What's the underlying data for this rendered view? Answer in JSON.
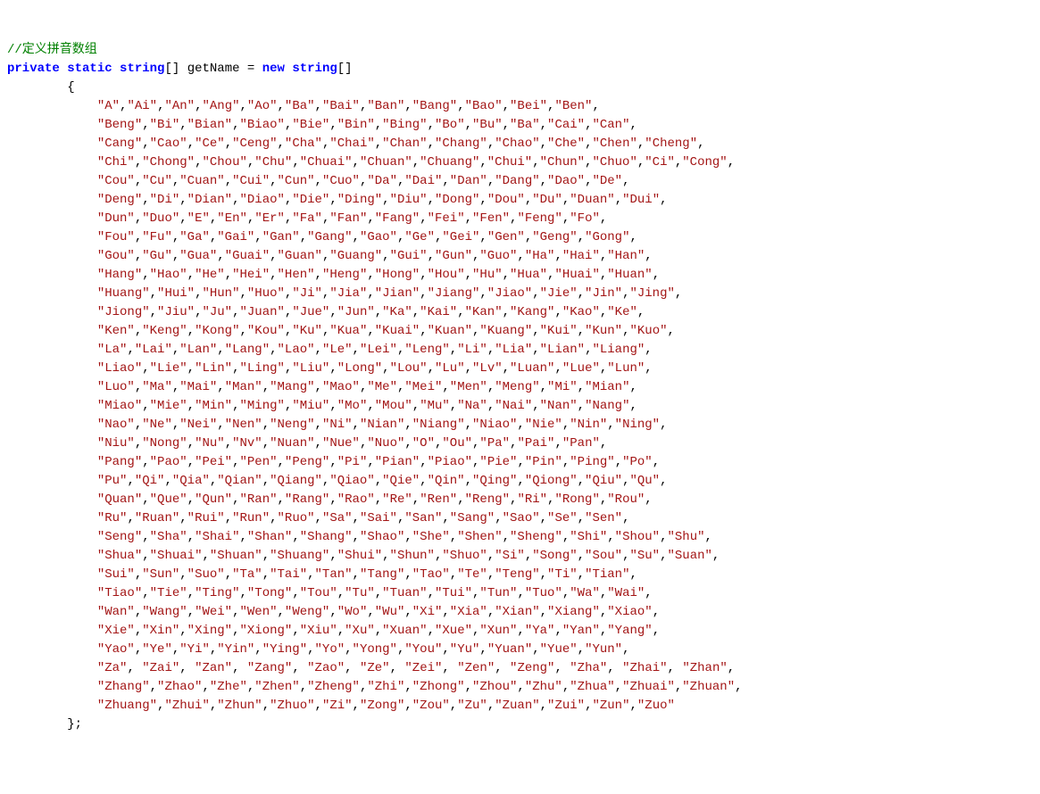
{
  "comment": "//定义拼音数组",
  "decl": {
    "kw_private": "private",
    "kw_static": "static",
    "type1": "string",
    "bracket1": "[]",
    "name": "getName",
    "eq": "=",
    "kw_new": "new",
    "type2": "string",
    "bracket2": "[]"
  },
  "open_brace": "{",
  "close_brace": "};",
  "rows": [
    [
      "A",
      "Ai",
      "An",
      "Ang",
      "Ao",
      "Ba",
      "Bai",
      "Ban",
      "Bang",
      "Bao",
      "Bei",
      "Ben"
    ],
    [
      "Beng",
      "Bi",
      "Bian",
      "Biao",
      "Bie",
      "Bin",
      "Bing",
      "Bo",
      "Bu",
      "Ba",
      "Cai",
      "Can"
    ],
    [
      "Cang",
      "Cao",
      "Ce",
      "Ceng",
      "Cha",
      "Chai",
      "Chan",
      "Chang",
      "Chao",
      "Che",
      "Chen",
      "Cheng"
    ],
    [
      "Chi",
      "Chong",
      "Chou",
      "Chu",
      "Chuai",
      "Chuan",
      "Chuang",
      "Chui",
      "Chun",
      "Chuo",
      "Ci",
      "Cong"
    ],
    [
      "Cou",
      "Cu",
      "Cuan",
      "Cui",
      "Cun",
      "Cuo",
      "Da",
      "Dai",
      "Dan",
      "Dang",
      "Dao",
      "De"
    ],
    [
      "Deng",
      "Di",
      "Dian",
      "Diao",
      "Die",
      "Ding",
      "Diu",
      "Dong",
      "Dou",
      "Du",
      "Duan",
      "Dui"
    ],
    [
      "Dun",
      "Duo",
      "E",
      "En",
      "Er",
      "Fa",
      "Fan",
      "Fang",
      "Fei",
      "Fen",
      "Feng",
      "Fo"
    ],
    [
      "Fou",
      "Fu",
      "Ga",
      "Gai",
      "Gan",
      "Gang",
      "Gao",
      "Ge",
      "Gei",
      "Gen",
      "Geng",
      "Gong"
    ],
    [
      "Gou",
      "Gu",
      "Gua",
      "Guai",
      "Guan",
      "Guang",
      "Gui",
      "Gun",
      "Guo",
      "Ha",
      "Hai",
      "Han"
    ],
    [
      "Hang",
      "Hao",
      "He",
      "Hei",
      "Hen",
      "Heng",
      "Hong",
      "Hou",
      "Hu",
      "Hua",
      "Huai",
      "Huan"
    ],
    [
      "Huang",
      "Hui",
      "Hun",
      "Huo",
      "Ji",
      "Jia",
      "Jian",
      "Jiang",
      "Jiao",
      "Jie",
      "Jin",
      "Jing"
    ],
    [
      "Jiong",
      "Jiu",
      "Ju",
      "Juan",
      "Jue",
      "Jun",
      "Ka",
      "Kai",
      "Kan",
      "Kang",
      "Kao",
      "Ke"
    ],
    [
      "Ken",
      "Keng",
      "Kong",
      "Kou",
      "Ku",
      "Kua",
      "Kuai",
      "Kuan",
      "Kuang",
      "Kui",
      "Kun",
      "Kuo"
    ],
    [
      "La",
      "Lai",
      "Lan",
      "Lang",
      "Lao",
      "Le",
      "Lei",
      "Leng",
      "Li",
      "Lia",
      "Lian",
      "Liang"
    ],
    [
      "Liao",
      "Lie",
      "Lin",
      "Ling",
      "Liu",
      "Long",
      "Lou",
      "Lu",
      "Lv",
      "Luan",
      "Lue",
      "Lun"
    ],
    [
      "Luo",
      "Ma",
      "Mai",
      "Man",
      "Mang",
      "Mao",
      "Me",
      "Mei",
      "Men",
      "Meng",
      "Mi",
      "Mian"
    ],
    [
      "Miao",
      "Mie",
      "Min",
      "Ming",
      "Miu",
      "Mo",
      "Mou",
      "Mu",
      "Na",
      "Nai",
      "Nan",
      "Nang"
    ],
    [
      "Nao",
      "Ne",
      "Nei",
      "Nen",
      "Neng",
      "Ni",
      "Nian",
      "Niang",
      "Niao",
      "Nie",
      "Nin",
      "Ning"
    ],
    [
      "Niu",
      "Nong",
      "Nu",
      "Nv",
      "Nuan",
      "Nue",
      "Nuo",
      "O",
      "Ou",
      "Pa",
      "Pai",
      "Pan"
    ],
    [
      "Pang",
      "Pao",
      "Pei",
      "Pen",
      "Peng",
      "Pi",
      "Pian",
      "Piao",
      "Pie",
      "Pin",
      "Ping",
      "Po"
    ],
    [
      "Pu",
      "Qi",
      "Qia",
      "Qian",
      "Qiang",
      "Qiao",
      "Qie",
      "Qin",
      "Qing",
      "Qiong",
      "Qiu",
      "Qu"
    ],
    [
      "Quan",
      "Que",
      "Qun",
      "Ran",
      "Rang",
      "Rao",
      "Re",
      "Ren",
      "Reng",
      "Ri",
      "Rong",
      "Rou"
    ],
    [
      "Ru",
      "Ruan",
      "Rui",
      "Run",
      "Ruo",
      "Sa",
      "Sai",
      "San",
      "Sang",
      "Sao",
      "Se",
      "Sen"
    ],
    [
      "Seng",
      "Sha",
      "Shai",
      "Shan",
      "Shang",
      "Shao",
      "She",
      "Shen",
      "Sheng",
      "Shi",
      "Shou",
      "Shu"
    ],
    [
      "Shua",
      "Shuai",
      "Shuan",
      "Shuang",
      "Shui",
      "Shun",
      "Shuo",
      "Si",
      "Song",
      "Sou",
      "Su",
      "Suan"
    ],
    [
      "Sui",
      "Sun",
      "Suo",
      "Ta",
      "Tai",
      "Tan",
      "Tang",
      "Tao",
      "Te",
      "Teng",
      "Ti",
      "Tian"
    ],
    [
      "Tiao",
      "Tie",
      "Ting",
      "Tong",
      "Tou",
      "Tu",
      "Tuan",
      "Tui",
      "Tun",
      "Tuo",
      "Wa",
      "Wai"
    ],
    [
      "Wan",
      "Wang",
      "Wei",
      "Wen",
      "Weng",
      "Wo",
      "Wu",
      "Xi",
      "Xia",
      "Xian",
      "Xiang",
      "Xiao"
    ],
    [
      "Xie",
      "Xin",
      "Xing",
      "Xiong",
      "Xiu",
      "Xu",
      "Xuan",
      "Xue",
      "Xun",
      "Ya",
      "Yan",
      "Yang"
    ],
    [
      "Yao",
      "Ye",
      "Yi",
      "Yin",
      "Ying",
      "Yo",
      "Yong",
      "You",
      "Yu",
      "Yuan",
      "Yue",
      "Yun"
    ],
    [
      "Za",
      "Zai",
      "Zan",
      "Zang",
      "Zao",
      "Ze",
      "Zei",
      "Zen",
      "Zeng",
      "Zha",
      "Zhai",
      "Zhan"
    ],
    [
      "Zhang",
      "Zhao",
      "Zhe",
      "Zhen",
      "Zheng",
      "Zhi",
      "Zhong",
      "Zhou",
      "Zhu",
      "Zhua",
      "Zhuai",
      "Zhuan"
    ],
    [
      "Zhuang",
      "Zhui",
      "Zhun",
      "Zhuo",
      "Zi",
      "Zong",
      "Zou",
      "Zu",
      "Zuan",
      "Zui",
      "Zun",
      "Zuo"
    ]
  ],
  "za_row_index": 30
}
